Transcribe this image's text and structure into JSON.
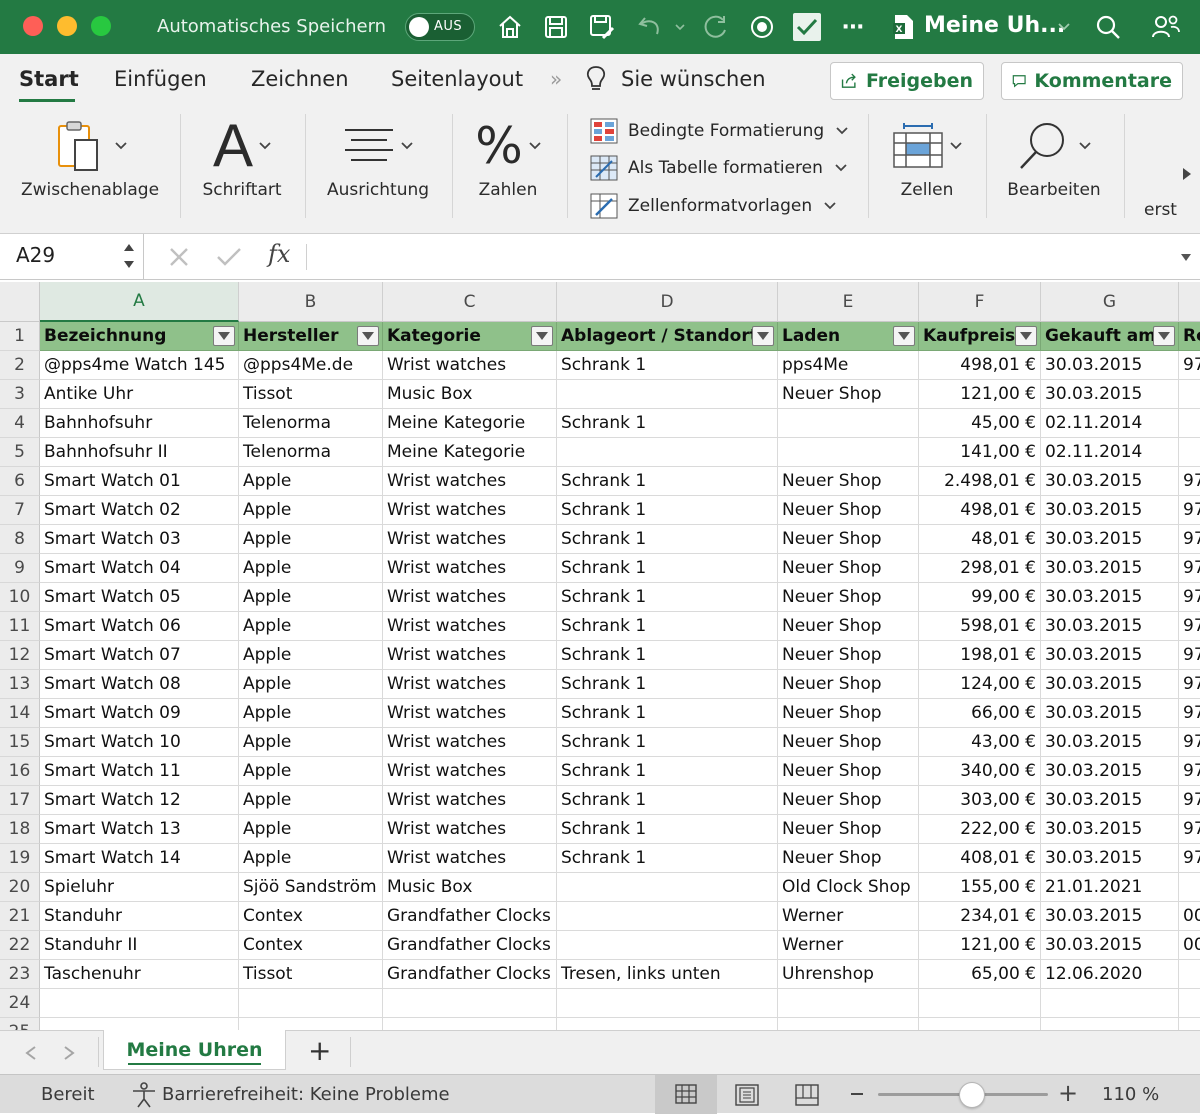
{
  "titlebar": {
    "autosave_label": "Automatisches Speichern",
    "autosave_state": "AUS",
    "document_title": "Meine Uh..."
  },
  "menu": {
    "tabs": [
      "Start",
      "Einfügen",
      "Zeichnen",
      "Seitenlayout"
    ],
    "tell_me": "Sie wünschen",
    "share_label": "Freigeben",
    "comments_label": "Kommentare"
  },
  "ribbon": {
    "clipboard": "Zwischenablage",
    "font": "Schriftart",
    "alignment": "Ausrichtung",
    "number": "Zahlen",
    "conditional_formatting": "Bedingte Formatierung",
    "format_as_table": "Als Tabelle formatieren",
    "cell_styles": "Zellenformatvorlagen",
    "cells": "Zellen",
    "editing": "Bearbeiten",
    "cut_off": "erst"
  },
  "formula_bar": {
    "name_box": "A29",
    "fx_symbol": "fx",
    "formula": ""
  },
  "sheet": {
    "columns": [
      "A",
      "B",
      "C",
      "D",
      "E",
      "F",
      "G"
    ],
    "header_row": [
      "Bezeichnung",
      "Hersteller",
      "Kategorie",
      "Ablageort / Standort",
      "Laden",
      "Kaufpreis",
      "Gekauft am",
      "Re"
    ],
    "rows": [
      [
        "@pps4me Watch 145",
        "@pps4Me.de",
        "Wrist watches",
        "Schrank 1",
        "pps4Me",
        "498,01 €",
        "30.03.2015",
        "97"
      ],
      [
        "Antike Uhr",
        "Tissot",
        "Music Box",
        "",
        "Neuer Shop",
        "121,00 €",
        "30.03.2015",
        ""
      ],
      [
        "Bahnhofsuhr",
        "Telenorma",
        "Meine Kategorie",
        "Schrank 1",
        "",
        "45,00 €",
        "02.11.2014",
        ""
      ],
      [
        "Bahnhofsuhr II",
        "Telenorma",
        "Meine Kategorie",
        "",
        "",
        "141,00 €",
        "02.11.2014",
        ""
      ],
      [
        "Smart Watch 01",
        "Apple",
        "Wrist watches",
        "Schrank 1",
        "Neuer Shop",
        "2.498,01 €",
        "30.03.2015",
        "97"
      ],
      [
        "Smart Watch 02",
        "Apple",
        "Wrist watches",
        "Schrank 1",
        "Neuer Shop",
        "498,01 €",
        "30.03.2015",
        "97"
      ],
      [
        "Smart Watch 03",
        "Apple",
        "Wrist watches",
        "Schrank 1",
        "Neuer Shop",
        "48,01 €",
        "30.03.2015",
        "97"
      ],
      [
        "Smart Watch 04",
        "Apple",
        "Wrist watches",
        "Schrank 1",
        "Neuer Shop",
        "298,01 €",
        "30.03.2015",
        "97"
      ],
      [
        "Smart Watch 05",
        "Apple",
        "Wrist watches",
        "Schrank 1",
        "Neuer Shop",
        "99,00 €",
        "30.03.2015",
        "97"
      ],
      [
        "Smart Watch 06",
        "Apple",
        "Wrist watches",
        "Schrank 1",
        "Neuer Shop",
        "598,01 €",
        "30.03.2015",
        "97"
      ],
      [
        "Smart Watch 07",
        "Apple",
        "Wrist watches",
        "Schrank 1",
        "Neuer Shop",
        "198,01 €",
        "30.03.2015",
        "97"
      ],
      [
        "Smart Watch 08",
        "Apple",
        "Wrist watches",
        "Schrank 1",
        "Neuer Shop",
        "124,00 €",
        "30.03.2015",
        "97"
      ],
      [
        "Smart Watch 09",
        "Apple",
        "Wrist watches",
        "Schrank 1",
        "Neuer Shop",
        "66,00 €",
        "30.03.2015",
        "97"
      ],
      [
        "Smart Watch 10",
        "Apple",
        "Wrist watches",
        "Schrank 1",
        "Neuer Shop",
        "43,00 €",
        "30.03.2015",
        "97"
      ],
      [
        "Smart Watch 11",
        "Apple",
        "Wrist watches",
        "Schrank 1",
        "Neuer Shop",
        "340,00 €",
        "30.03.2015",
        "97"
      ],
      [
        "Smart Watch 12",
        "Apple",
        "Wrist watches",
        "Schrank 1",
        "Neuer Shop",
        "303,00 €",
        "30.03.2015",
        "97"
      ],
      [
        "Smart Watch 13",
        "Apple",
        "Wrist watches",
        "Schrank 1",
        "Neuer Shop",
        "222,00 €",
        "30.03.2015",
        "97"
      ],
      [
        "Smart Watch 14",
        "Apple",
        "Wrist watches",
        "Schrank 1",
        "Neuer Shop",
        "408,01 €",
        "30.03.2015",
        "97"
      ],
      [
        "Spieluhr",
        "Sjöö Sandström",
        "Music Box",
        "",
        "Old Clock Shop",
        "155,00 €",
        "21.01.2021",
        ""
      ],
      [
        "Standuhr",
        "Contex",
        "Grandfather Clocks",
        "",
        "Werner",
        "234,01 €",
        "30.03.2015",
        "00"
      ],
      [
        "Standuhr II",
        "Contex",
        "Grandfather Clocks",
        "",
        "Werner",
        "121,00 €",
        "30.03.2015",
        "00"
      ],
      [
        "Taschenuhr",
        "Tissot",
        "Grandfather Clocks",
        "Tresen, links unten",
        "Uhrenshop",
        "65,00 €",
        "12.06.2020",
        ""
      ]
    ]
  },
  "sheet_tabs": {
    "active": "Meine Uhren",
    "add_symbol": "+"
  },
  "status": {
    "ready": "Bereit",
    "accessibility": "Barrierefreiheit: Keine Probleme",
    "zoom": "110 %",
    "zoom_level": 0.55
  },
  "colors": {
    "accent": "#237a43",
    "header_fill": "#8fc18a"
  }
}
